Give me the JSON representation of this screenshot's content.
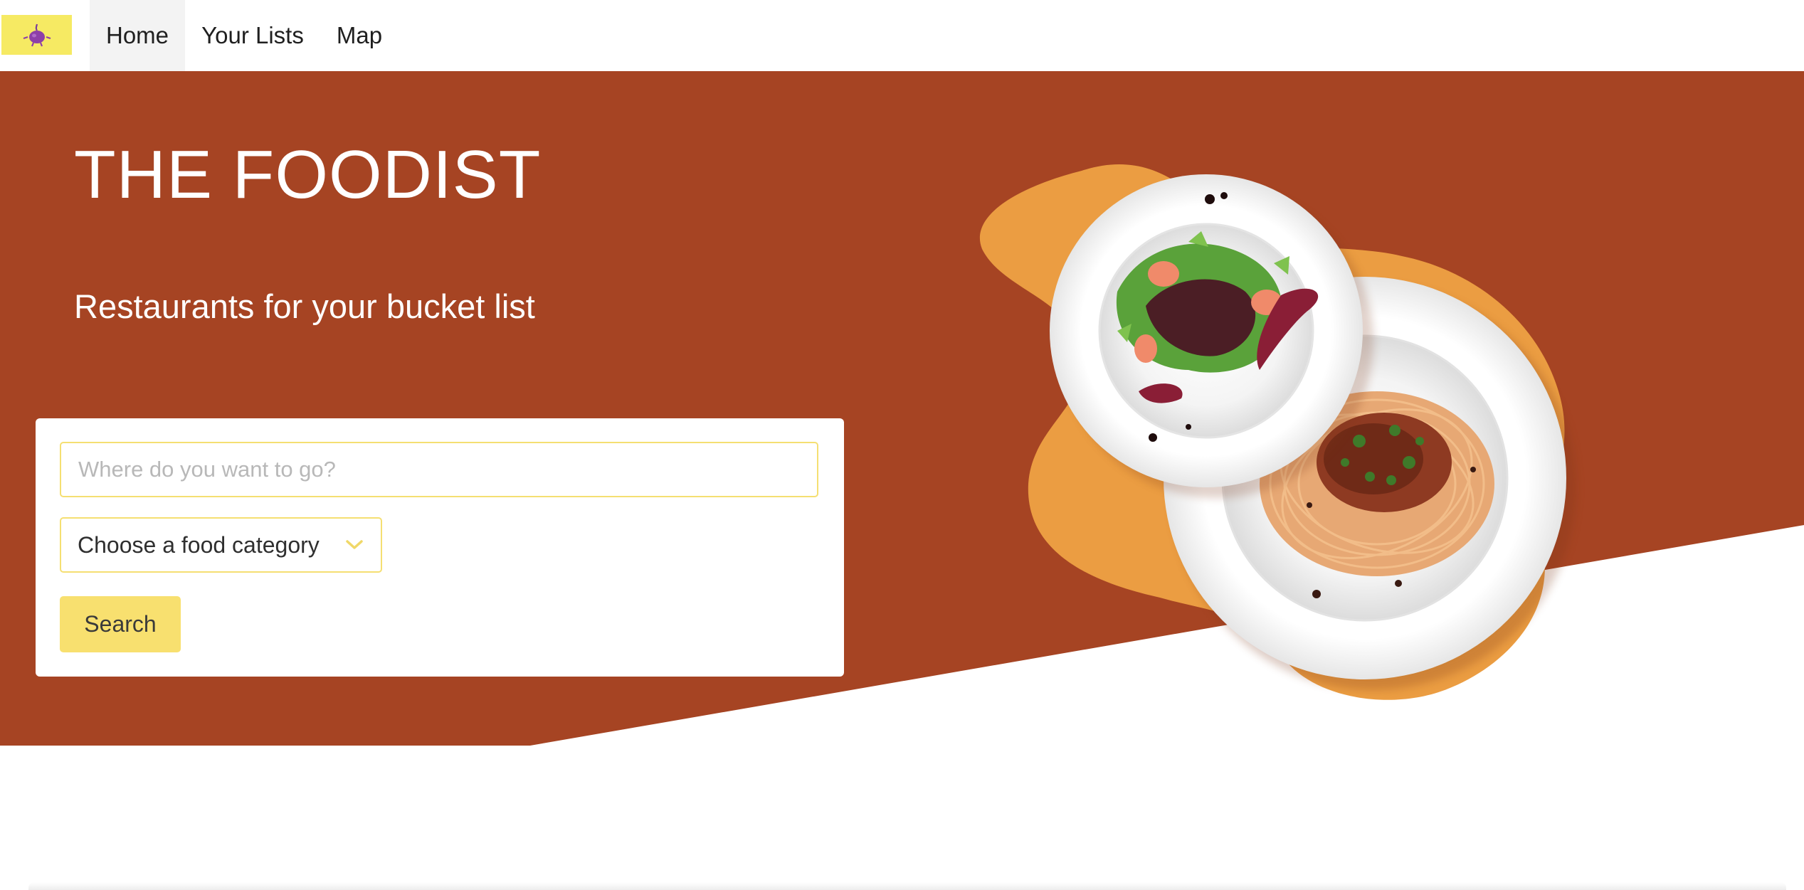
{
  "nav": {
    "logo_icon": "onion-mascot-icon",
    "items": [
      {
        "label": "Home",
        "active": true
      },
      {
        "label": "Your Lists",
        "active": false
      },
      {
        "label": "Map",
        "active": false
      }
    ]
  },
  "hero": {
    "title": "THE FOODIST",
    "subtitle": "Restaurants for your bucket list",
    "image": "plates-of-salad-and-spaghetti"
  },
  "search": {
    "placeholder": "Where do you want to go?",
    "value": "",
    "category": {
      "selected": "Choose a food category",
      "icon": "chevron-down-icon"
    },
    "button_label": "Search"
  },
  "colors": {
    "hero_background": "#a64423",
    "accent_yellow": "#f8e06f",
    "blob_orange": "#eb9d42",
    "logo_background": "#f6ea63"
  }
}
